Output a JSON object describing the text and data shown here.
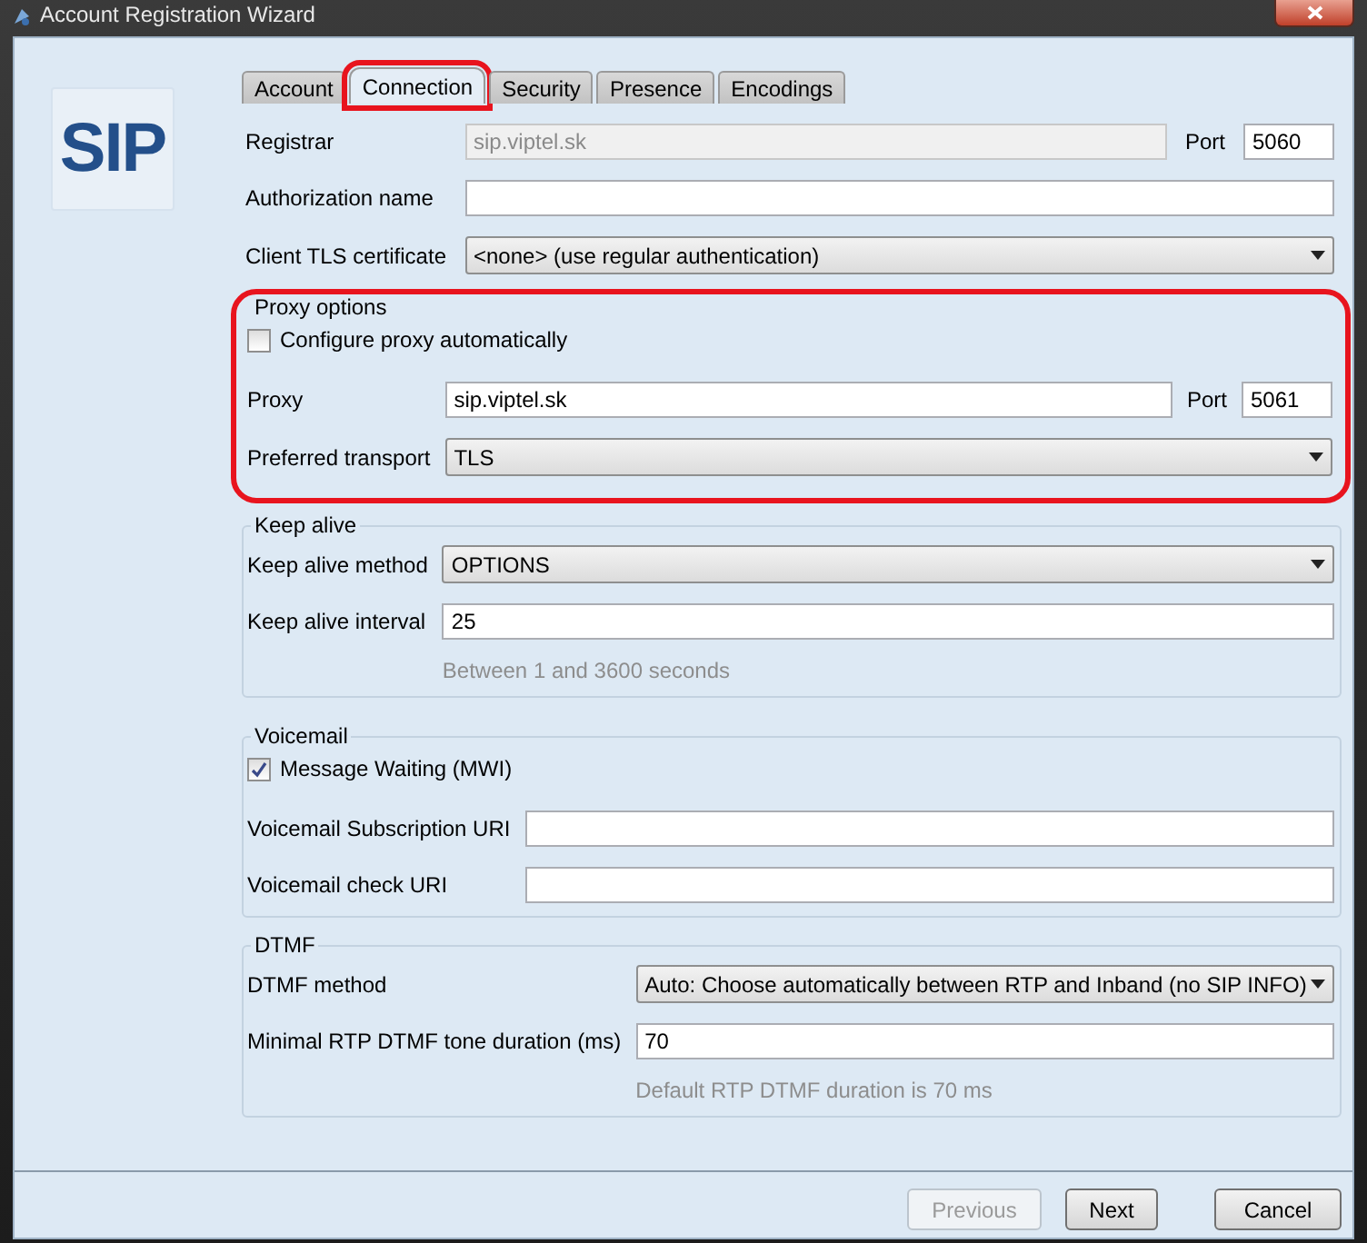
{
  "window": {
    "title": "Account Registration Wizard"
  },
  "logo": {
    "text": "SIP"
  },
  "tabs": [
    {
      "label": "Account",
      "selected": false,
      "highlighted": false
    },
    {
      "label": "Connection",
      "selected": true,
      "highlighted": true
    },
    {
      "label": "Security",
      "selected": false,
      "highlighted": false
    },
    {
      "label": "Presence",
      "selected": false,
      "highlighted": false
    },
    {
      "label": "Encodings",
      "selected": false,
      "highlighted": false
    }
  ],
  "fields": [
    {
      "kind": "text",
      "label": "Registrar",
      "value": "sip.viptel.sk",
      "disabled": true,
      "port_label": "Port",
      "port_value": "5060"
    },
    {
      "kind": "text",
      "label": "Authorization name",
      "disabled": false
    },
    {
      "kind": "select",
      "label": "Client TLS certificate",
      "value": "<none> (use regular authentication)"
    }
  ],
  "groups": [
    {
      "title": "Proxy options",
      "highlighted": true,
      "rows": [
        {
          "kind": "checkbox",
          "label": "Configure proxy automatically",
          "checked": false
        },
        {
          "kind": "text",
          "label": "Proxy",
          "value": "sip.viptel.sk",
          "disabled": false,
          "port_label": "Port",
          "port_value": "5061"
        },
        {
          "kind": "select",
          "label": "Preferred transport",
          "value": "TLS"
        }
      ]
    },
    {
      "title": "Keep alive",
      "highlighted": false,
      "rows": [
        {
          "kind": "select",
          "label": "Keep alive method",
          "value": "OPTIONS"
        },
        {
          "kind": "text",
          "label": "Keep alive interval",
          "value": "25",
          "disabled": false
        },
        {
          "kind": "hint",
          "text": "Between 1 and 3600 seconds"
        }
      ]
    },
    {
      "title": "Voicemail",
      "highlighted": false,
      "rows": [
        {
          "kind": "checkbox",
          "label": "Message Waiting (MWI)",
          "checked": true
        },
        {
          "kind": "text",
          "label": "Voicemail Subscription URI",
          "disabled": false
        },
        {
          "kind": "text",
          "label": "Voicemail check URI",
          "disabled": false
        }
      ]
    },
    {
      "title": "DTMF",
      "highlighted": false,
      "rows": [
        {
          "kind": "select",
          "label": "DTMF method",
          "value": "Auto: Choose automatically between RTP and Inband (no SIP INFO)"
        },
        {
          "kind": "text",
          "label": "Minimal RTP DTMF tone duration (ms)",
          "value": "70",
          "disabled": false
        },
        {
          "kind": "hint",
          "text": "Default RTP DTMF duration is 70 ms"
        }
      ]
    }
  ],
  "buttons": [
    {
      "label": "Previous",
      "disabled": true
    },
    {
      "label": "Next",
      "disabled": false
    },
    {
      "label": "Cancel",
      "disabled": false
    }
  ]
}
